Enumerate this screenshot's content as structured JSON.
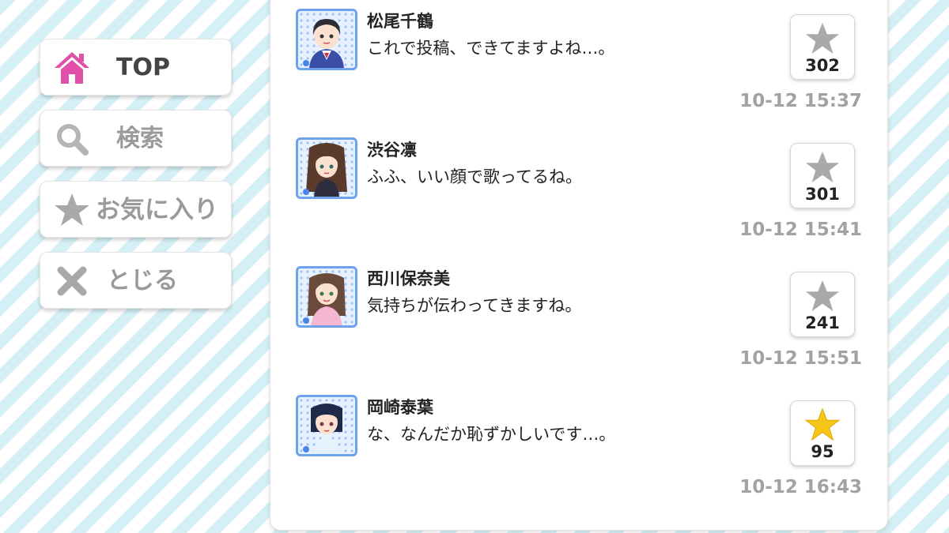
{
  "nav": {
    "top_label": "TOP",
    "search_label": "検索",
    "favorites_label": "お気に入り",
    "close_label": "とじる"
  },
  "colors": {
    "accent_pink": "#e04fa8",
    "favorited_star": "#f5c518",
    "unfavorited_star": "#a9a9a9",
    "avatar_frame": "#6da2ef",
    "stripe": "#d4f0f6"
  },
  "icons": {
    "top": "home-icon",
    "search": "search-icon",
    "favorites": "star-icon",
    "close": "close-icon"
  },
  "posts": [
    {
      "name": "松尾千鶴",
      "message": "これで投稿、できてますよね…。",
      "likes": "302",
      "time": "10-12 15:37",
      "starred": false
    },
    {
      "name": "渋谷凛",
      "message": "ふふ、いい顔で歌ってるね。",
      "likes": "301",
      "time": "10-12 15:41",
      "starred": false
    },
    {
      "name": "西川保奈美",
      "message": "気持ちが伝わってきますね。",
      "likes": "241",
      "time": "10-12 15:51",
      "starred": false
    },
    {
      "name": "岡崎泰葉",
      "message": "な、なんだか恥ずかしいです…。",
      "likes": "95",
      "time": "10-12 16:43",
      "starred": true
    }
  ]
}
